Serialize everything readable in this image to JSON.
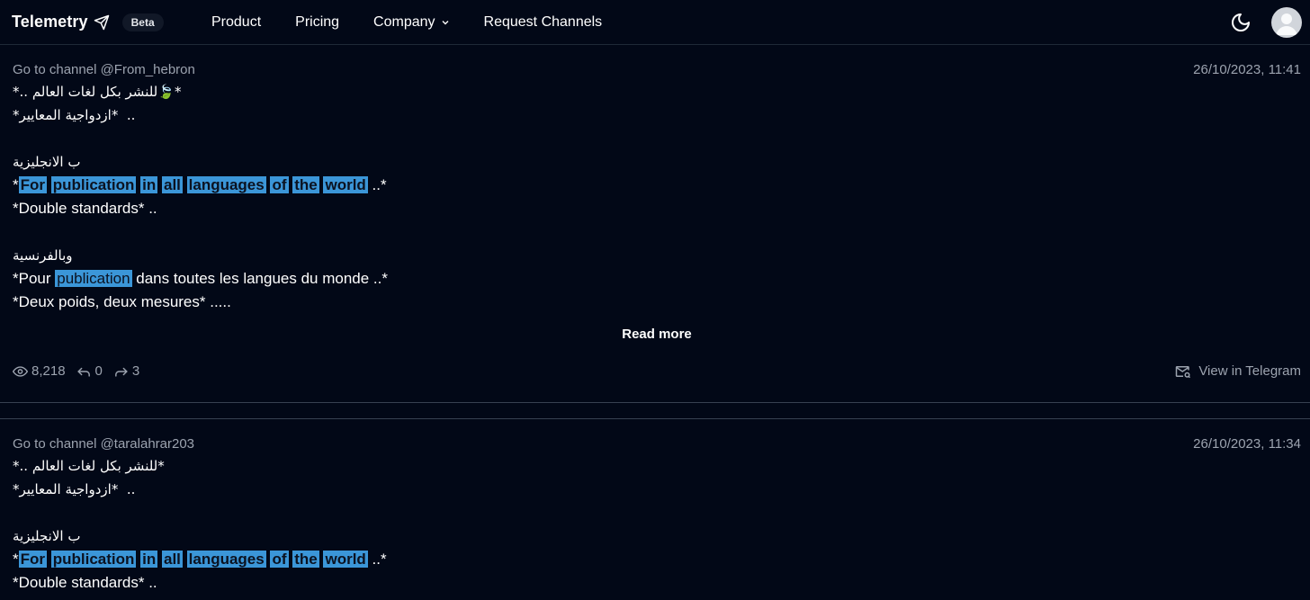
{
  "header": {
    "brand": "Telemetry",
    "beta": "Beta",
    "nav": [
      "Product",
      "Pricing",
      "Company",
      "Request Channels"
    ]
  },
  "posts": [
    {
      "channel": "Go to channel @From_hebron",
      "date": "26/10/2023, 11:41",
      "lines": {
        "ar1": "*.. للنشر بكل لغات العالم🍃*",
        "ar2": "*ازدواجية المعايير*  ..",
        "ar3": "ب الانجليزية",
        "en_words": [
          "For",
          "publication",
          "in",
          "all",
          "languages",
          "of",
          "the",
          "world"
        ],
        "en_prefix": "*",
        "en_suffix": " ..*",
        "en2": "*Double standards* ..",
        "ar4": "وبالفرنسية",
        "fr_prefix": "*Pour ",
        "fr_hl": "publication",
        "fr_suffix": " dans toutes les langues du monde ..*",
        "fr2": "*Deux poids, deux mesures* ....."
      },
      "read_more": "Read more",
      "views": "8,218",
      "replies": "0",
      "forwards": "3",
      "view_in": "View in Telegram"
    },
    {
      "channel": "Go to channel @taralahrar203",
      "date": "26/10/2023, 11:34",
      "lines": {
        "ar1": "*.. للنشر بكل لغات العالم*",
        "ar2": "*ازدواجية المعايير*  ..",
        "ar3": "ب الانجليزية",
        "en_words": [
          "For",
          "publication",
          "in",
          "all",
          "languages",
          "of",
          "the",
          "world"
        ],
        "en_prefix": "*",
        "en_suffix": " ..*",
        "en2": "*Double standards* .."
      }
    }
  ]
}
